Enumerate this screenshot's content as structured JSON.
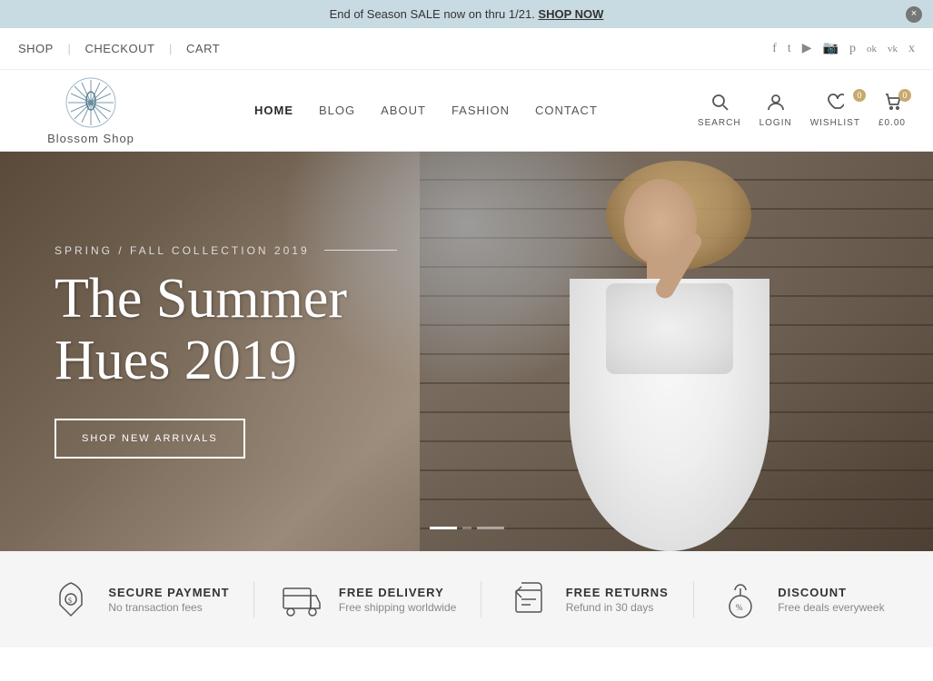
{
  "announcement": {
    "text": "End of Season SALE now on thru 1/21.",
    "cta_text": "SHOP NOW",
    "close_label": "×"
  },
  "secondary_nav": {
    "links": [
      {
        "label": "SHOP",
        "href": "#"
      },
      {
        "label": "CHECKOUT",
        "href": "#"
      },
      {
        "label": "CART",
        "href": "#"
      }
    ]
  },
  "social_icons": [
    {
      "name": "facebook-icon",
      "symbol": "f"
    },
    {
      "name": "twitter-icon",
      "symbol": "t"
    },
    {
      "name": "youtube-icon",
      "symbol": "▶"
    },
    {
      "name": "instagram-icon",
      "symbol": "📷"
    },
    {
      "name": "pinterest-icon",
      "symbol": "p"
    },
    {
      "name": "odnoklassniki-icon",
      "symbol": "ok"
    },
    {
      "name": "vk-icon",
      "symbol": "vk"
    },
    {
      "name": "xing-icon",
      "symbol": "x"
    }
  ],
  "logo": {
    "text": "Blossom Shop"
  },
  "main_nav": {
    "items": [
      {
        "label": "HOME",
        "active": true
      },
      {
        "label": "BLOG",
        "active": false
      },
      {
        "label": "ABOUT",
        "active": false
      },
      {
        "label": "FASHION",
        "active": false
      },
      {
        "label": "CONTACT",
        "active": false
      }
    ]
  },
  "header_actions": {
    "search_label": "SEARCH",
    "login_label": "LOGIN",
    "wishlist_label": "WISHLIST",
    "wishlist_count": "0",
    "cart_label": "£0.00",
    "cart_count": "0"
  },
  "hero": {
    "subtitle": "SPRING / FALL COLLECTION 2019",
    "title_line1": "The Summer",
    "title_line2": "Hues 2019",
    "cta_label": "SHOP NEW ARRIVALS"
  },
  "features": [
    {
      "id": "secure-payment",
      "title": "SECURE PAYMENT",
      "subtitle": "No transaction fees",
      "icon_name": "secure-payment-icon"
    },
    {
      "id": "free-delivery",
      "title": "FREE DELIVERY",
      "subtitle": "Free shipping worldwide",
      "icon_name": "free-delivery-icon"
    },
    {
      "id": "free-returns",
      "title": "FREE RETURNS",
      "subtitle": "Refund in 30 days",
      "icon_name": "free-returns-icon"
    },
    {
      "id": "discount",
      "title": "DISCOUNT",
      "subtitle": "Free deals everyweek",
      "icon_name": "discount-icon"
    }
  ]
}
